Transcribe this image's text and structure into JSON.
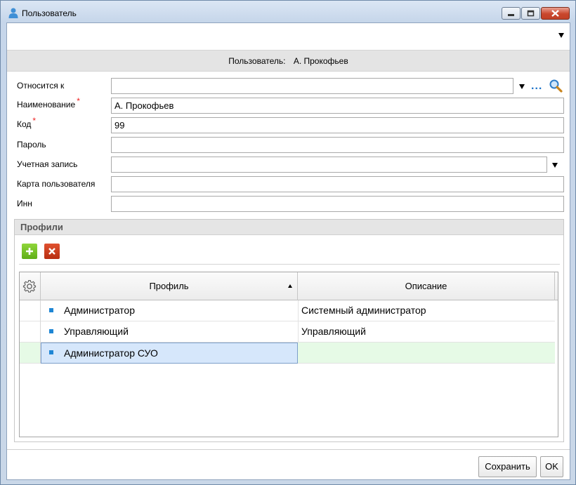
{
  "window": {
    "title": "Пользователь"
  },
  "header": {
    "label": "Пользователь:",
    "value": "А. Прокофьев"
  },
  "fields": {
    "belongs_to": {
      "label": "Относится к",
      "value": ""
    },
    "name": {
      "label": "Наименование",
      "value": "А. Прокофьев",
      "required_mark": "*"
    },
    "code": {
      "label": "Код",
      "value": "99",
      "required_mark": "*"
    },
    "password": {
      "label": "Пароль",
      "value": ""
    },
    "account": {
      "label": "Учетная запись",
      "value": ""
    },
    "user_card": {
      "label": "Карта пользователя",
      "value": ""
    },
    "inn": {
      "label": "Инн",
      "value": ""
    }
  },
  "browse_dots": "...",
  "profiles": {
    "title": "Профили",
    "columns": {
      "profile": "Профиль",
      "description": "Описание"
    },
    "rows": [
      {
        "profile": "Администратор",
        "description": "Системный администратор"
      },
      {
        "profile": "Управляющий",
        "description": "Управляющий"
      },
      {
        "profile": "Администратор СУО",
        "description": ""
      }
    ]
  },
  "buttons": {
    "save": "Сохранить",
    "ok": "OK"
  },
  "colors": {
    "accent_blue": "#1f86d4",
    "required": "#e22222",
    "add_green": "#6cbf1f",
    "delete_red": "#c93a1b",
    "active_row": "#e6fae6"
  },
  "icons": [
    "user-icon",
    "minimize-icon",
    "maximize-icon",
    "close-icon",
    "dropdown-arrow-icon",
    "magnifier-icon",
    "plus-icon",
    "cross-icon",
    "gear-icon",
    "sort-asc-icon"
  ]
}
